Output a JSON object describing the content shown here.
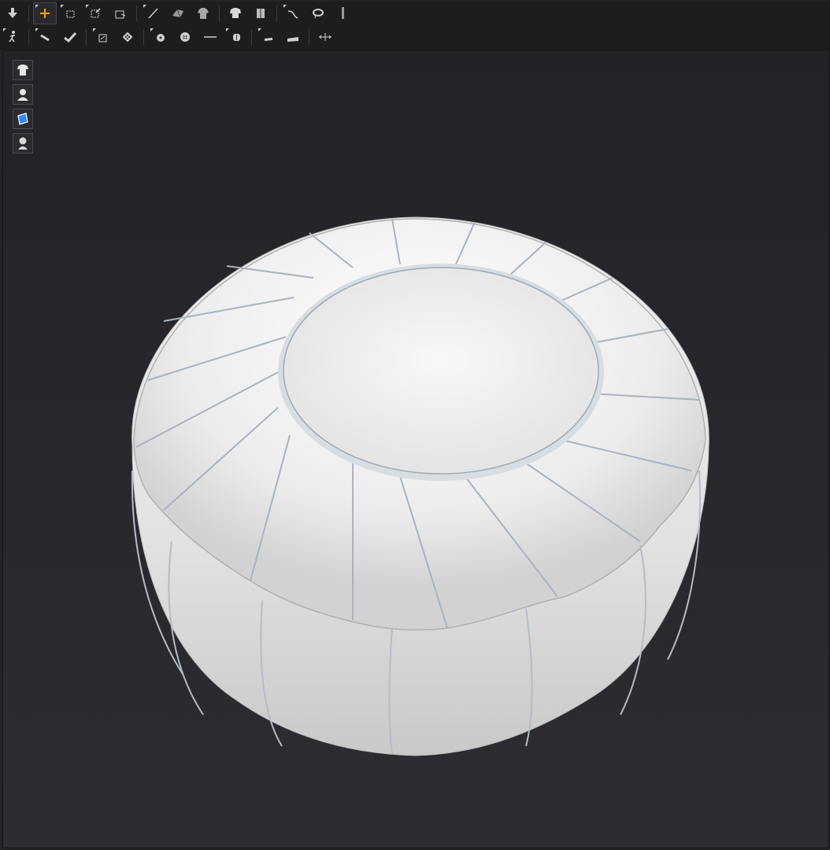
{
  "toolbar": {
    "row1": [
      {
        "icon": "down-arrow-icon"
      },
      {
        "icon": "select-move-icon",
        "active": true
      },
      {
        "icon": "select-box-icon"
      },
      {
        "icon": "transform-icon"
      },
      {
        "icon": "edit-pattern-icon"
      },
      {
        "icon": "segment-line-icon"
      },
      {
        "icon": "fold-icon"
      },
      {
        "icon": "garment-icon"
      },
      {
        "icon": "tshirt-icon"
      },
      {
        "icon": "fit-icon"
      },
      {
        "icon": "curve-icon"
      },
      {
        "icon": "lasso-icon"
      },
      {
        "icon": "vertical-bar-icon"
      }
    ],
    "row2": [
      {
        "icon": "avatar-walk-icon"
      },
      {
        "icon": "pin-icon"
      },
      {
        "icon": "tack-icon"
      },
      {
        "icon": "fold-arrange-icon"
      },
      {
        "icon": "pattern-grid-icon"
      },
      {
        "icon": "button-icon"
      },
      {
        "icon": "circle-button-icon"
      },
      {
        "icon": "line-icon"
      },
      {
        "icon": "button-hole-icon"
      },
      {
        "icon": "zipper-icon"
      },
      {
        "icon": "flat-icon"
      },
      {
        "icon": "measure-icon"
      }
    ]
  },
  "side_tools": [
    {
      "icon": "show-garment-icon"
    },
    {
      "icon": "show-avatar-icon"
    },
    {
      "icon": "texture-icon",
      "accent": "#2a8cff"
    },
    {
      "icon": "avatar-silhouette-icon"
    }
  ],
  "viewport": {
    "object": "leather-pouf-model"
  }
}
